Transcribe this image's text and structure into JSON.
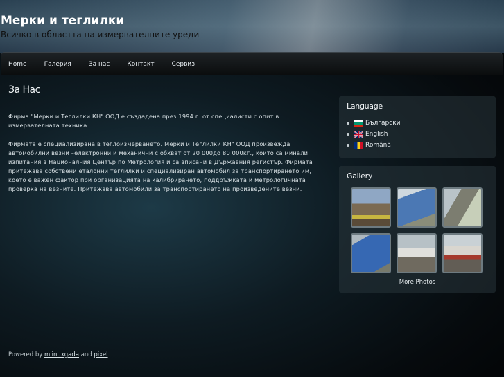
{
  "header": {
    "title": "Мерки и теглилки",
    "tagline": "Всичко в областта на измервателните уреди"
  },
  "nav": [
    {
      "label": "Home"
    },
    {
      "label": "Галерия"
    },
    {
      "label": "За нас"
    },
    {
      "label": "Контакт"
    },
    {
      "label": "Сервиз"
    }
  ],
  "main": {
    "heading": "За Нас",
    "paragraphs": [
      "Фирма \"Мерки и Теглилки КН\" ООД е създадена през 1994 г. от специалисти с опит в измервателната техника.",
      "Фирмата е специализирана в теглоизмерването.  Мерки и Теглилки КН\" ООД произвежда автомобилни везни –електронни и механични с обхват от 20 000до 80 000кг., които са минали изпитания в Националния Център по Метрология и са вписани в Държавния регистър. Фирмата притежава собствени еталонни теглилки и специализиран автомобил за транспортирането им, което е важен фактор при организацията на калибрирането, поддръжката и метрологичната проверка на везните. Притежава автомобили за транспортирането на произведените везни."
    ]
  },
  "sidebar": {
    "language_title": "Language",
    "languages": [
      {
        "label": "Български",
        "flag": "bulgaria-flag-icon"
      },
      {
        "label": "English",
        "flag": "uk-flag-icon"
      },
      {
        "label": "Română",
        "flag": "romania-flag-icon"
      }
    ],
    "gallery_title": "Gallery",
    "more_label": "More Photos"
  },
  "footer": {
    "prefix": "Powered by",
    "link1": "mlinuxgada",
    "joiner": "and",
    "link2": "pixel"
  },
  "colors": {
    "nav_bg": "#0a0c0d",
    "page_bg": "#0e1b22",
    "box_bg": "#28343a"
  }
}
